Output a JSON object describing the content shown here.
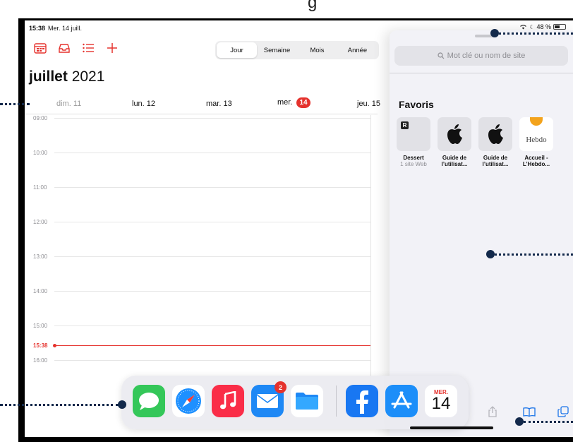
{
  "status": {
    "time": "15:38",
    "date": "Mer. 14 juill.",
    "battery": "48 %"
  },
  "calendar": {
    "view_modes": [
      "Jour",
      "Semaine",
      "Mois",
      "Année"
    ],
    "active_view": "Jour",
    "month_bold": "juillet",
    "year": "2021",
    "days": [
      {
        "label": "dim. 11",
        "past": true
      },
      {
        "label": "lun. 12",
        "past": false
      },
      {
        "label": "mar. 13",
        "past": false
      },
      {
        "label": "mer.",
        "badge": "14",
        "past": false
      },
      {
        "label": "jeu. 15",
        "past": false
      }
    ],
    "hours": [
      "09:00",
      "10:00",
      "11:00",
      "12:00",
      "13:00",
      "14:00",
      "15:00",
      "16:00"
    ],
    "now_label": "15:38"
  },
  "safari": {
    "search_placeholder": "Mot clé ou nom de site",
    "favorites_title": "Favoris",
    "favorites": [
      {
        "name": "Dessert",
        "sub": "1 site Web"
      },
      {
        "name": "Guide de",
        "sub": "l’utilisat..."
      },
      {
        "name": "Guide de",
        "sub": "l’utilisat..."
      },
      {
        "name": "Accueil -",
        "sub": "L’Hebdo..."
      }
    ],
    "hebdo_logo": "Hebdo"
  },
  "dock": {
    "mail_badge": "2",
    "calendar_month": "MER.",
    "calendar_day": "14"
  },
  "colors": {
    "accent_red": "#e5322d",
    "callout": "#13294b"
  }
}
